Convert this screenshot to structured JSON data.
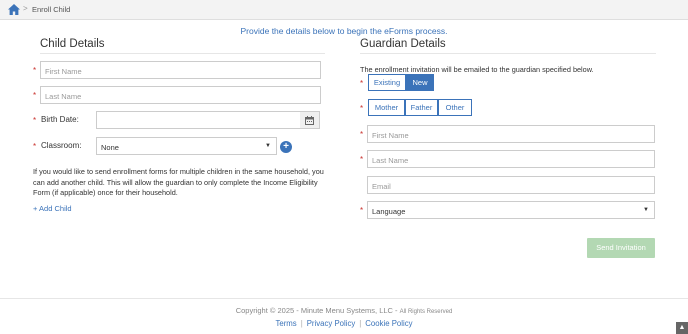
{
  "breadcrumb": {
    "home_icon": "home-icon",
    "separator": ">",
    "current": "Enroll Child"
  },
  "intro": "Provide the details below to begin the eForms process.",
  "child": {
    "title": "Child Details",
    "first_name_placeholder": "First Name",
    "last_name_placeholder": "Last Name",
    "birth_date_label": "Birth Date:",
    "birth_date_value": "",
    "calendar_icon": "calendar-icon",
    "classroom_label": "Classroom:",
    "classroom_value": "None",
    "add_classroom_icon": "plus-circle-icon",
    "help_text": "If you would like to send enrollment forms for multiple children in the same household, you can add another child. This will allow the guardian to only complete the Income Eligibility Form (if applicable) once for their household.",
    "add_child_label": "+ Add Child"
  },
  "guardian": {
    "title": "Guardian Details",
    "note": "The enrollment invitation will be emailed to the guardian specified below.",
    "type_options": [
      "Existing",
      "New"
    ],
    "type_selected": "New",
    "relation_options": [
      "Mother",
      "Father",
      "Other"
    ],
    "first_name_placeholder": "First Name",
    "last_name_placeholder": "Last Name",
    "email_placeholder": "Email",
    "language_value": "Language",
    "send_label": "Send Invitation"
  },
  "footer": {
    "copyright": "Copyright © 2025 - Minute Menu Systems, LLC -",
    "rights": "All Rights Reserved",
    "links": [
      "Terms",
      "Privacy Policy",
      "Cookie Policy"
    ],
    "link_separator": "|",
    "scroll_top_icon": "chevron-up-icon",
    "scroll_top_glyph": "▲"
  },
  "colors": {
    "accent": "#3b73b9",
    "required": "#c9302c",
    "send_disabled": "#b3d8b3"
  }
}
